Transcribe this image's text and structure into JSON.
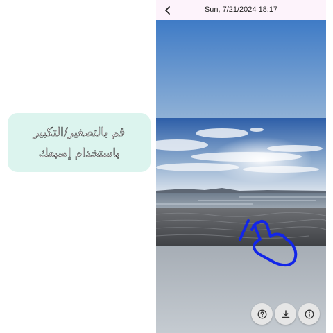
{
  "hint": {
    "line1": "قم بالتصغير/التكبير",
    "line2": "باستخدام إصبعك"
  },
  "header": {
    "date_title": "Sun, 7/21/2024  18:17",
    "back_icon": "chevron-left-icon"
  },
  "photo": {
    "subject": "beach-sunset-photo",
    "gesture_icon": "pinch-zoom-hand-icon",
    "gesture_color": "#1326e8"
  },
  "actions": [
    {
      "icon": "help-icon"
    },
    {
      "icon": "download-icon"
    },
    {
      "icon": "info-icon"
    }
  ]
}
